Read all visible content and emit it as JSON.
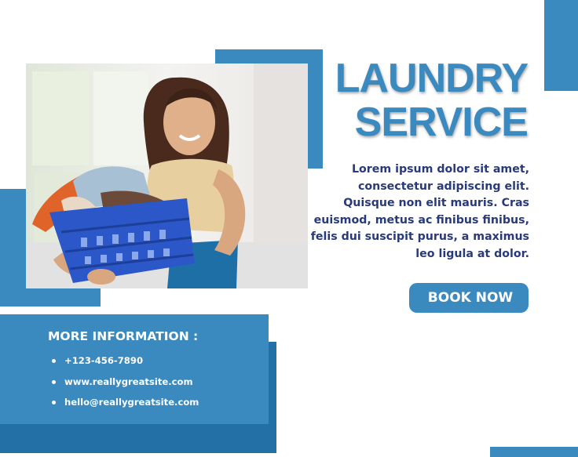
{
  "title": {
    "line1": "LAUNDRY",
    "line2": "SERVICE"
  },
  "description": "Lorem ipsum dolor sit amet, consectetur adipiscing elit. Quisque non elit mauris. Cras euismod, metus ac finibus finibus, felis dui suscipit purus, a maximus leo ligula at dolor.",
  "book_button": "BOOK NOW",
  "info": {
    "title": "MORE INFORMATION :",
    "items": [
      "+123-456-7890",
      "www.reallygreatsite.com",
      "hello@reallygreatsite.com"
    ]
  },
  "colors": {
    "accent": "#3a89bf",
    "accent_dark": "#2370a6",
    "text_dark": "#283a7a",
    "background": "#ffffff"
  },
  "icons": {
    "bullet": "bullet-dot-icon"
  }
}
